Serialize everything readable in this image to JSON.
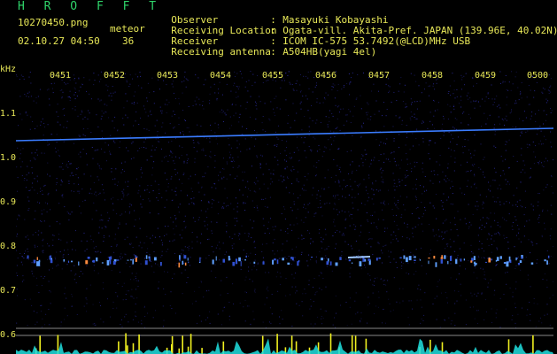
{
  "header": {
    "brand": "H R O F F T",
    "filename": "10270450.png",
    "datetime": "02.10.27 04:50",
    "meteor_label": "meteor",
    "meteor_count": "36"
  },
  "info": [
    {
      "key": "Observer",
      "value": "Masayuki Kobayashi"
    },
    {
      "key": "Receiving Location",
      "value": "Ogata-vill. Akita-Pref. JAPAN (139.96E, 40.02N)"
    },
    {
      "key": "Receiver",
      "value": "ICOM IC-575 53.7492(@LCD)MHz USB"
    },
    {
      "key": "Receiving antenna",
      "value": "A504HB(yagi 4el)"
    }
  ],
  "axis": {
    "y_unit": "kHz",
    "y_ticks": [
      "1.1",
      "1.0",
      "0.9",
      "0.8",
      "0.7",
      "0.6"
    ],
    "x_ticks": [
      "0451",
      "0452",
      "0453",
      "0454",
      "0455",
      "0456",
      "0457",
      "0458",
      "0459",
      "0500"
    ]
  },
  "colors": {
    "text": "#e8e858",
    "brand": "#2fd36a",
    "noise": "#2a2a9a",
    "carrier": "#3a7cff",
    "meteor_bar": "#f0f020",
    "meteor_fill": "#20e0e0"
  }
}
